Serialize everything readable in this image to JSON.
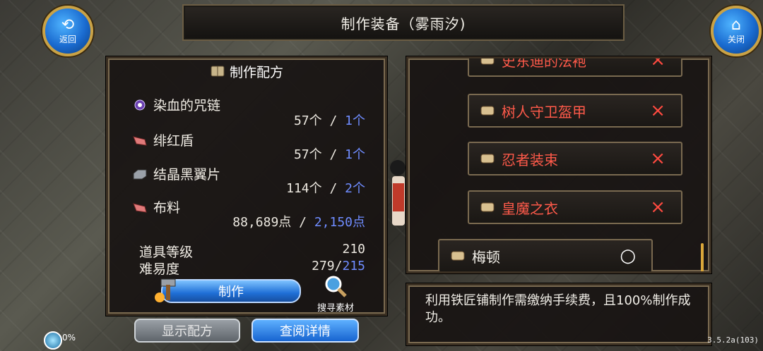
{
  "window": {
    "title": "制作装备（雾雨汐)"
  },
  "nav": {
    "back_label": "返回",
    "close_label": "关闭"
  },
  "recipe": {
    "header": "制作配方",
    "materials": [
      {
        "name": "染血的咒链",
        "icon": "orb-icon",
        "owned": "57个",
        "need": "1个"
      },
      {
        "name": "绯红盾",
        "icon": "hide-icon",
        "owned": "57个",
        "need": "1个"
      },
      {
        "name": "结晶黑翼片",
        "icon": "ingot-icon",
        "owned": "114个",
        "need": "2个"
      },
      {
        "name": "布料",
        "icon": "cloth-icon",
        "owned": "88,689点",
        "need": "2,150点"
      }
    ],
    "item_level_label": "道具等级",
    "item_level_value": "210",
    "difficulty_label": "难易度",
    "difficulty_current": "279",
    "difficulty_max": "215",
    "make_label": "制作",
    "search_label": "搜寻素材"
  },
  "buttons": {
    "show_recipe": "显示配方",
    "view_detail": "查阅详情"
  },
  "equipment_list": [
    {
      "name": "史东迪的法袍",
      "status": "×",
      "available": false
    },
    {
      "name": "树人守卫盔甲",
      "status": "×",
      "available": false
    },
    {
      "name": "忍者装束",
      "status": "×",
      "available": false
    },
    {
      "name": "皇魔之衣",
      "status": "×",
      "available": false
    },
    {
      "name": "梅顿",
      "status": "○",
      "available": true
    }
  ],
  "description": "利用铁匠铺制作需缴纳手续费，且100%制作成功。",
  "status": {
    "percent": "0%"
  },
  "version": "3.5.2a(103)",
  "colors": {
    "accent_blue": "#1f6fd6",
    "unavailable_red": "#ff5a4a",
    "need_blue": "#6f8cff",
    "frame_gold": "#c9a246"
  }
}
